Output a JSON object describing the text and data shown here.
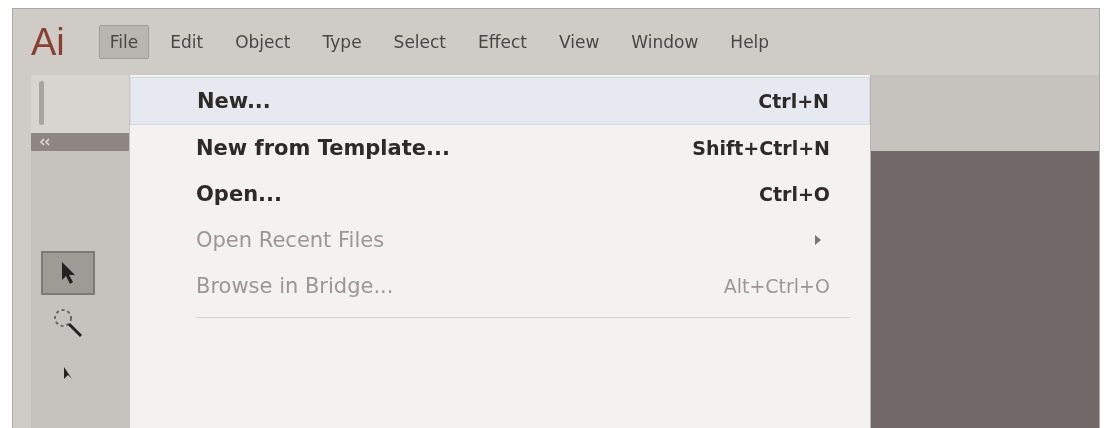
{
  "app": {
    "logo": "Ai"
  },
  "menu_bar": [
    {
      "label": "File",
      "selected": true
    },
    {
      "label": "Edit",
      "selected": false
    },
    {
      "label": "Object",
      "selected": false
    },
    {
      "label": "Type",
      "selected": false
    },
    {
      "label": "Select",
      "selected": false
    },
    {
      "label": "Effect",
      "selected": false
    },
    {
      "label": "View",
      "selected": false
    },
    {
      "label": "Window",
      "selected": false
    },
    {
      "label": "Help",
      "selected": false
    }
  ],
  "file_menu": [
    {
      "label": "New...",
      "shortcut": "Ctrl+N",
      "disabled": false,
      "selected": true,
      "submenu": false
    },
    {
      "label": "New from Template...",
      "shortcut": "Shift+Ctrl+N",
      "disabled": false,
      "selected": false,
      "submenu": false
    },
    {
      "label": "Open...",
      "shortcut": "Ctrl+O",
      "disabled": false,
      "selected": false,
      "submenu": false
    },
    {
      "label": "Open Recent Files",
      "disabled": true,
      "selected": false,
      "submenu": true
    },
    {
      "label": "Browse in Bridge...",
      "shortcut": "Alt+Ctrl+O",
      "disabled": true,
      "selected": false,
      "submenu": false
    }
  ],
  "tools": [
    {
      "kind": "selection",
      "selected": true
    },
    {
      "kind": "magic-wand",
      "selected": false
    },
    {
      "kind": "direct-selection",
      "selected": false
    }
  ]
}
